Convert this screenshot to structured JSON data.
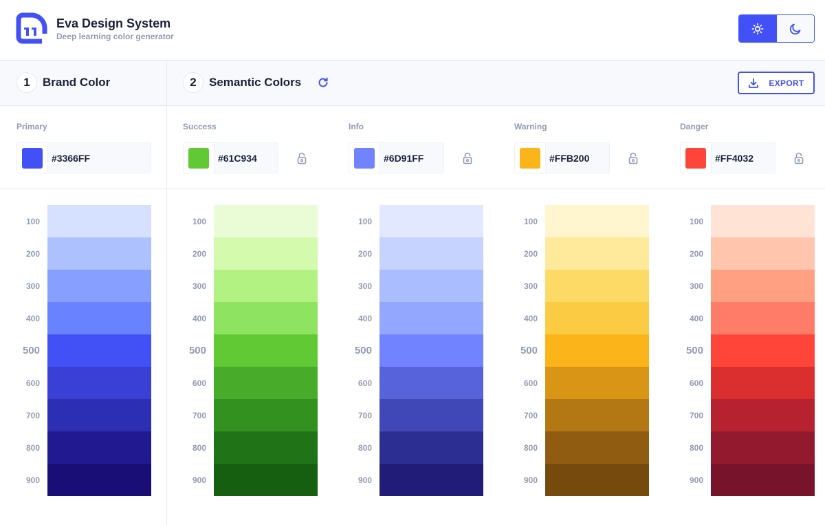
{
  "header": {
    "title": "Eva Design System",
    "subtitle": "Deep learning color generator",
    "logo_icon": "eva-logo-icon",
    "theme_toggle": {
      "options": [
        {
          "name": "light",
          "icon": "sun-icon",
          "active": true
        },
        {
          "name": "dark",
          "icon": "moon-icon",
          "active": false
        }
      ]
    }
  },
  "sections": {
    "brand": {
      "number": "1",
      "label": "Brand Color"
    },
    "semantic": {
      "number": "2",
      "label": "Semantic Colors",
      "refresh_icon": "refresh-icon"
    },
    "export_label": "EXPORT",
    "export_icon": "download-icon"
  },
  "colors": {
    "accent": "#4251F5",
    "label_gray": "#8F9BB3",
    "text_dark": "#1A2138"
  },
  "fields": [
    {
      "key": "primary",
      "label": "Primary",
      "hex": "#3366FF",
      "swatch": "#4251F5",
      "lockable": false
    },
    {
      "key": "success",
      "label": "Success",
      "hex": "#61C934",
      "swatch": "#61C934",
      "lockable": true
    },
    {
      "key": "info",
      "label": "Info",
      "hex": "#6D91FF",
      "swatch": "#7183FF",
      "lockable": true
    },
    {
      "key": "warning",
      "label": "Warning",
      "hex": "#FFB200",
      "swatch": "#FBB51A",
      "lockable": true
    },
    {
      "key": "danger",
      "label": "Danger",
      "hex": "#FF4032",
      "swatch": "#FF4539",
      "lockable": true
    }
  ],
  "shade_labels": [
    "100",
    "200",
    "300",
    "400",
    "500",
    "600",
    "700",
    "800",
    "900"
  ],
  "palettes": {
    "primary": [
      "#D6E0FF",
      "#ADC1FF",
      "#879FFF",
      "#6982FF",
      "#4251F5",
      "#3A40D6",
      "#2C2EB3",
      "#20198F",
      "#190E75"
    ],
    "success": [
      "#EAFCD6",
      "#D4FAAE",
      "#B2F282",
      "#8EE361",
      "#61C934",
      "#48AB2A",
      "#32911F",
      "#217317",
      "#165F11"
    ],
    "info": [
      "#E1E8FF",
      "#C6D3FF",
      "#AABDFF",
      "#94A7FF",
      "#7183FF",
      "#5663DA",
      "#4047B6",
      "#2D2E92",
      "#221C79"
    ],
    "warning": [
      "#FFF6CF",
      "#FEEA9A",
      "#FDD966",
      "#FBCB43",
      "#FBB51A",
      "#D99515",
      "#B37714",
      "#8F5C11",
      "#764A0D"
    ],
    "danger": [
      "#FFE4D6",
      "#FFC5AD",
      "#FFA083",
      "#FF7C69",
      "#FF4539",
      "#DB2E2F",
      "#B62230",
      "#931A2E",
      "#78132C"
    ]
  }
}
